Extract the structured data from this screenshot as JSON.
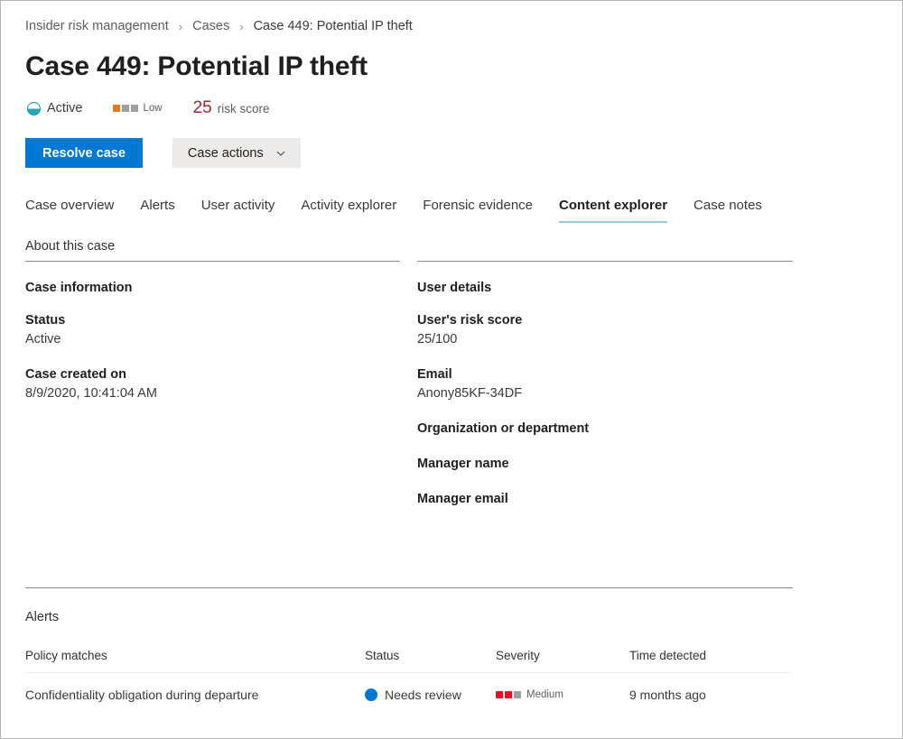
{
  "breadcrumb": {
    "items": [
      {
        "label": "Insider risk management"
      },
      {
        "label": "Cases"
      },
      {
        "label": "Case 449: Potential IP theft"
      }
    ],
    "separator": "›"
  },
  "page_title": "Case 449: Potential IP theft",
  "status_row": {
    "status_label": "Active",
    "status_icon": "half-filled-circle-icon",
    "status_color": "#2aa6b3",
    "severity_label": "Low",
    "severity_filled": 1,
    "severity_total": 3,
    "severity_color": "#e8751a",
    "severity_empty_color": "#a19f9d",
    "risk_score_value": "25",
    "risk_score_label": "risk score",
    "risk_score_color": "#a4262c"
  },
  "toolbar": {
    "resolve_label": "Resolve case",
    "resolve_color": "#0078d4",
    "case_actions_label": "Case actions",
    "case_actions_icon": "chevron-down-icon"
  },
  "tabs": {
    "items": [
      {
        "label": "Case overview",
        "selected": false
      },
      {
        "label": "Alerts",
        "selected": false
      },
      {
        "label": "User activity",
        "selected": false
      },
      {
        "label": "Activity explorer",
        "selected": false
      },
      {
        "label": "Forensic evidence",
        "selected": false
      },
      {
        "label": "Content explorer",
        "selected": true
      },
      {
        "label": "Case notes",
        "selected": false
      }
    ],
    "selected_underline_color": "#9cc9e8"
  },
  "about": {
    "heading": "About this case",
    "left": {
      "heading": "Case information",
      "fields": [
        {
          "label": "Status",
          "value": "Active"
        },
        {
          "label": "Case created on",
          "value": "8/9/2020, 10:41:04 AM"
        }
      ]
    },
    "right": {
      "heading": "User details",
      "fields": [
        {
          "label": "User's risk score",
          "value": "25/100"
        },
        {
          "label": "Email",
          "value": "Anony85KF-34DF"
        },
        {
          "label": "Organization or department",
          "value": ""
        },
        {
          "label": "Manager name",
          "value": ""
        },
        {
          "label": "Manager email",
          "value": ""
        }
      ]
    }
  },
  "alerts": {
    "heading": "Alerts",
    "columns": [
      "Policy matches",
      "Status",
      "Severity",
      "Time detected"
    ],
    "rows": [
      {
        "policy": "Confidentiality obligation during departure",
        "status": "Needs review",
        "status_color": "#0078d4",
        "status_icon": "filled-circle-icon",
        "severity": "Medium",
        "severity_filled": 2,
        "severity_total": 3,
        "severity_color": "#e81123",
        "severity_empty_color": "#a19f9d",
        "time_detected": "9 months ago"
      }
    ]
  }
}
